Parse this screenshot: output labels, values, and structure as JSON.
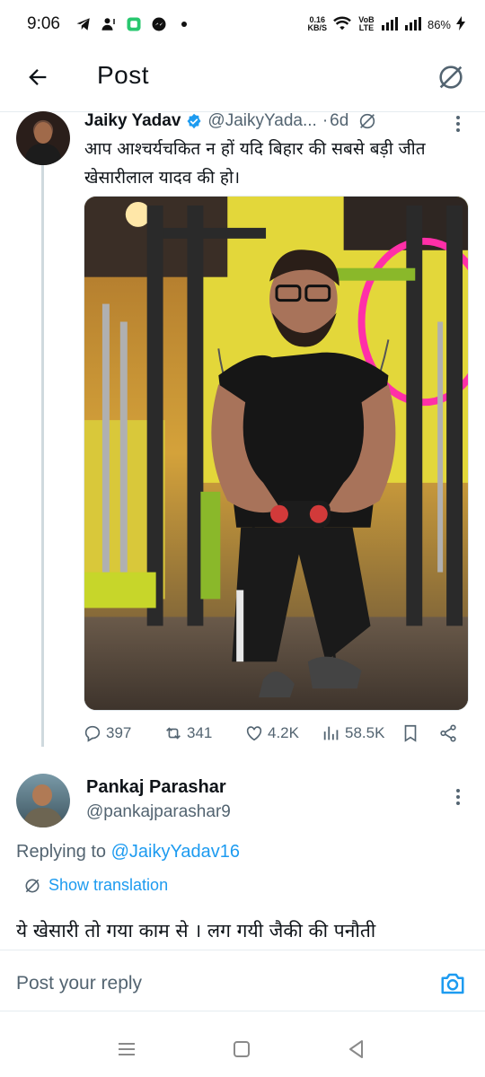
{
  "status_bar": {
    "time": "9:06",
    "icons": [
      "telegram-icon",
      "person-alert-icon",
      "app-icon",
      "messenger-icon",
      "dot-icon"
    ],
    "net_speed": "0.16",
    "net_unit": "KB/S",
    "volte": "VoB LTE",
    "battery": "86%"
  },
  "header": {
    "title": "Post"
  },
  "tweet": {
    "name": "Jaiky Yadav",
    "handle": "@JaikyYada...",
    "dot": "·",
    "time": "6d",
    "text": "आप आश्चर्यचकित न हों यदि बिहार की सबसे बड़ी जीत खेसारीलाल यादव की हो।",
    "stats": {
      "replies": "397",
      "reposts": "341",
      "likes": "4.2K",
      "views": "58.5K"
    }
  },
  "reply": {
    "name": "Pankaj Parashar",
    "handle": "@pankajparashar9",
    "replying_prefix": "Replying to ",
    "replying_handle": "@JaikyYadav16",
    "show_translation": "Show translation",
    "text": "ये खेसारी तो गया काम से । लग गयी जैकी की पनौती"
  },
  "composer": {
    "placeholder": "Post your reply"
  },
  "colors": {
    "accent": "#1d9bf0",
    "secondary_text": "#536471",
    "primary_text": "#0f1419"
  }
}
